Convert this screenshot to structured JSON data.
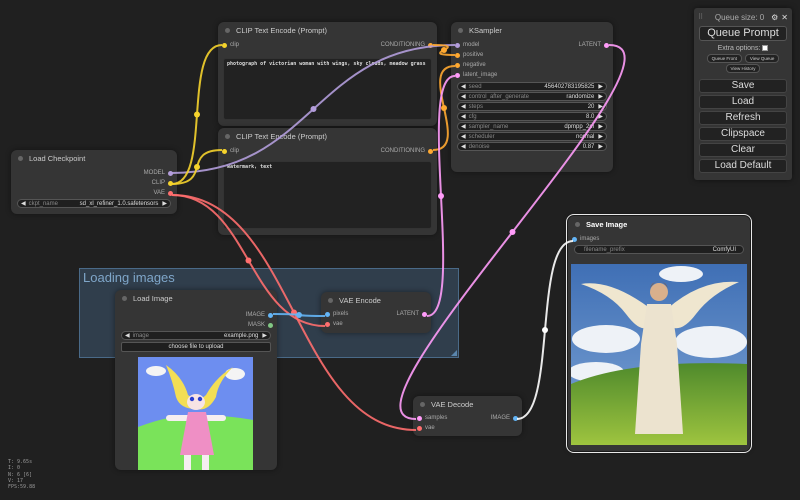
{
  "canvas": {
    "background": "#202020"
  },
  "group": {
    "title": "Loading images"
  },
  "nodes": {
    "load_checkpoint": {
      "title": "Load Checkpoint",
      "outputs": [
        "MODEL",
        "CLIP",
        "VAE"
      ],
      "widgets": [
        {
          "name": "ckpt_name",
          "value": "sd_xl_refiner_1.0.safetensors"
        }
      ]
    },
    "clip_positive": {
      "title": "CLIP Text Encode (Prompt)",
      "input": "clip",
      "output": "CONDITIONING",
      "text": "photograph of victorian woman with wings, sky clouds, meadow grass"
    },
    "clip_negative": {
      "title": "CLIP Text Encode (Prompt)",
      "input": "clip",
      "output": "CONDITIONING",
      "text": "watermark, text"
    },
    "ksampler": {
      "title": "KSampler",
      "inputs": [
        "model",
        "positive",
        "negative",
        "latent_image"
      ],
      "output": "LATENT",
      "widgets": [
        {
          "name": "seed",
          "value": "456402783195825"
        },
        {
          "name": "control_after_generate",
          "value": "randomize"
        },
        {
          "name": "steps",
          "value": "20"
        },
        {
          "name": "cfg",
          "value": "8.0"
        },
        {
          "name": "sampler_name",
          "value": "dpmpp_2m"
        },
        {
          "name": "scheduler",
          "value": "normal"
        },
        {
          "name": "denoise",
          "value": "0.87"
        }
      ]
    },
    "load_image": {
      "title": "Load Image",
      "outputs": [
        "IMAGE",
        "MASK"
      ],
      "widgets": [
        {
          "name": "image",
          "value": "example.png"
        }
      ],
      "upload_label": "choose file to upload",
      "preview": "child drawing of blonde girl with pink dress on green hill, blue sky"
    },
    "vae_encode": {
      "title": "VAE Encode",
      "inputs": [
        "pixels",
        "vae"
      ],
      "output": "LATENT"
    },
    "vae_decode": {
      "title": "VAE Decode",
      "inputs": [
        "samples",
        "vae"
      ],
      "output": "IMAGE"
    },
    "save_image": {
      "title": "Save Image",
      "input": "images",
      "widgets": [
        {
          "name": "filename_prefix",
          "value": "ComfyUI"
        }
      ],
      "preview": "photo of victorian woman with angel wings standing in meadow under cloudy sky"
    }
  },
  "link_colors": {
    "model": "#b39ddb",
    "clip": "#f5d32c",
    "vae": "#ff6e6e",
    "conditioning": "#ffa931",
    "latent": "#ff9cf9",
    "image": "#64b5f6",
    "image_out": "#ffffff"
  },
  "panel": {
    "queue_size": "Queue size: 0",
    "queue_prompt": "Queue Prompt",
    "extra_options": "Extra options:",
    "queue_front": "Queue Front",
    "view_queue": "View Queue",
    "view_history": "View History",
    "buttons": [
      "Save",
      "Load",
      "Refresh",
      "Clipspace",
      "Clear",
      "Load Default"
    ]
  },
  "stats": [
    "T: 9.65s",
    "I: 0",
    "N: 6 [6]",
    "V: 17",
    "FPS:59.88"
  ]
}
